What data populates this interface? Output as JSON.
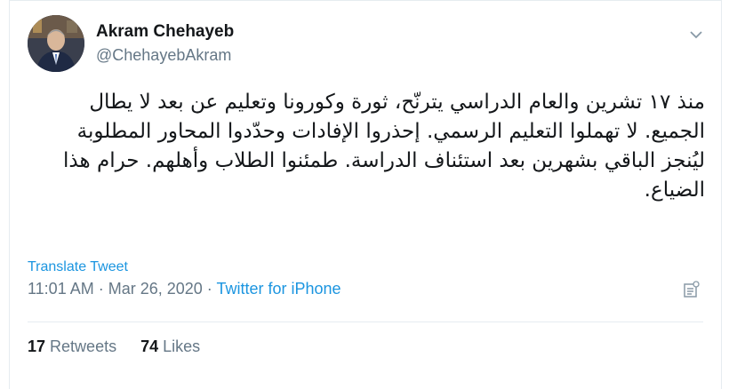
{
  "author": {
    "name": "Akram Chehayeb",
    "handle": "@ChehayebAkram"
  },
  "tweet": {
    "text": "منذ ١٧ تشرين والعام الدراسي يترنّح، ثورة وكورونا وتعليم عن بعد لا يطال الجميع. لا تهملوا التعليم الرسمي. إحذروا الإفادات وحدّدوا المحاور المطلوبة ليُنجز الباقي بشهرين بعد استئناف الدراسة. طمئنوا الطلاب وأهلهم. حرام هذا الضياع.",
    "translate_label": "Translate Tweet",
    "time": "11:01 AM",
    "separator1": " · ",
    "date": "Mar 26, 2020",
    "separator2": " · ",
    "source": "Twitter for iPhone"
  },
  "stats": {
    "retweets_count": "17",
    "retweets_label": "Retweets",
    "likes_count": "74",
    "likes_label": "Likes"
  },
  "colors": {
    "link": "#1b95e0",
    "secondary": "#657786",
    "primary": "#14171a",
    "border": "#e6ecf0"
  },
  "icons": {
    "menu": "chevron-down-icon",
    "analytics": "analytics-icon"
  }
}
